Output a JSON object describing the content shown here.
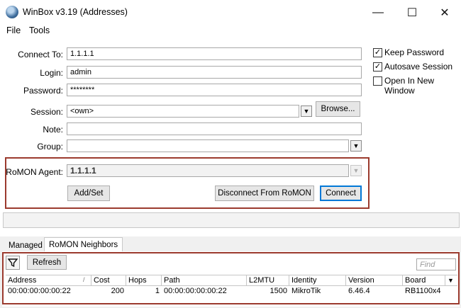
{
  "window": {
    "title": "WinBox v3.19 (Addresses)",
    "minimize": "—",
    "maximize": "☐",
    "close": "✕"
  },
  "menu": {
    "file": "File",
    "tools": "Tools"
  },
  "form": {
    "connect_to_label": "Connect To:",
    "connect_to_value": "1.1.1.1",
    "login_label": "Login:",
    "login_value": "admin",
    "password_label": "Password:",
    "password_value": "********",
    "session_label": "Session:",
    "session_value": "<own>",
    "browse_button": "Browse...",
    "note_label": "Note:",
    "note_value": "",
    "group_label": "Group:",
    "group_value": ""
  },
  "options": {
    "keep_password": "Keep Password",
    "keep_password_checked": true,
    "autosave_session": "Autosave Session",
    "autosave_session_checked": true,
    "open_new_window": "Open In New Window",
    "open_new_window_checked": false
  },
  "romon": {
    "agent_label": "RoMON Agent:",
    "agent_value": "1.1.1.1",
    "add_set_button": "Add/Set",
    "disconnect_button": "Disconnect From RoMON",
    "connect_button": "Connect"
  },
  "tabs": {
    "managed": "Managed",
    "romon_neighbors": "RoMON Neighbors"
  },
  "toolbar": {
    "refresh_button": "Refresh",
    "find_placeholder": "Find"
  },
  "table": {
    "columns": [
      "Address",
      "Cost",
      "Hops",
      "Path",
      "L2MTU",
      "Identity",
      "Version",
      "Board"
    ],
    "rows": [
      [
        "00:00:00:00:00:22",
        "200",
        "1",
        "00:00:00:00:00:22",
        "1500",
        "MikroTik",
        "6.46.4",
        "RB1100x4"
      ]
    ]
  }
}
